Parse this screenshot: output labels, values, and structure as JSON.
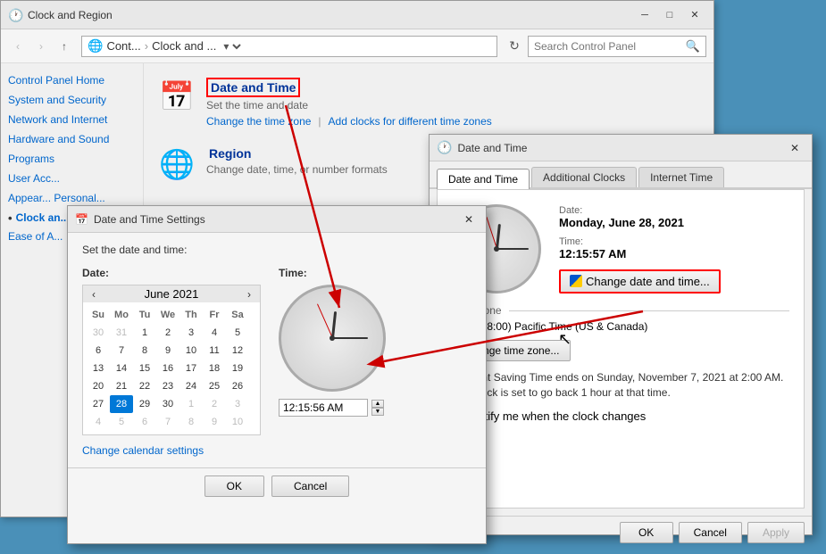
{
  "mainWindow": {
    "title": "Clock and Region",
    "icon": "🕐",
    "addressParts": [
      "Cont...",
      "Clock and ..."
    ],
    "searchPlaceholder": "Search Control Panel"
  },
  "sidebar": {
    "items": [
      {
        "label": "Control Panel Home"
      },
      {
        "label": "System and Security"
      },
      {
        "label": "Network and Internet"
      },
      {
        "label": "Hardware and Sound"
      },
      {
        "label": "Programs"
      },
      {
        "label": "User Acc..."
      },
      {
        "label": "Appear... Personal..."
      },
      {
        "label": "Clock an..."
      },
      {
        "label": "Ease of A..."
      }
    ]
  },
  "categories": [
    {
      "title": "Date and Time",
      "icon": "📅",
      "subtitle": "Set the time and date",
      "links": [
        "Change the time zone",
        "Add clocks for different time zones"
      ]
    },
    {
      "title": "Region",
      "icon": "🌐",
      "subtitle": "Change date, time, or number formats",
      "links": []
    }
  ],
  "dateTimeDialog": {
    "title": "Date and Time",
    "tabs": [
      "Date and Time",
      "Additional Clocks",
      "Internet Time"
    ],
    "activeTab": "Date and Time",
    "date": {
      "label": "Date:",
      "value": "Monday, June 28, 2021"
    },
    "time": {
      "label": "Time:",
      "value": "12:15:57 AM"
    },
    "changeBtn": "Change date and time...",
    "timezone": {
      "label": "Time zone",
      "value": "(UTC-08:00) Pacific Time (US & Canada)",
      "changeBtn": "Change time zone..."
    },
    "dstText": "Daylight Saving Time ends on Sunday, November 7, 2021 at 2:00 AM. The clock is set to go back 1 hour at that time.",
    "notifyLabel": "Notify me when the clock changes",
    "buttons": {
      "ok": "OK",
      "cancel": "Cancel",
      "apply": "Apply"
    }
  },
  "dtSettingsDialog": {
    "title": "Date and Time Settings",
    "instruction": "Set the date and time:",
    "dateLabel": "Date:",
    "timeLabel": "Time:",
    "calendar": {
      "month": "June 2021",
      "dayHeaders": [
        "Su",
        "Mo",
        "Tu",
        "We",
        "Th",
        "Fr",
        "Sa"
      ],
      "rows": [
        [
          "30",
          "31",
          "1",
          "2",
          "3",
          "4",
          "5"
        ],
        [
          "6",
          "7",
          "8",
          "9",
          "10",
          "11",
          "12"
        ],
        [
          "13",
          "14",
          "15",
          "16",
          "17",
          "18",
          "19"
        ],
        [
          "20",
          "21",
          "22",
          "23",
          "24",
          "25",
          "26"
        ],
        [
          "27",
          "28",
          "29",
          "30",
          "1",
          "2",
          "3"
        ],
        [
          "4",
          "5",
          "6",
          "7",
          "8",
          "9",
          "10"
        ]
      ],
      "selectedDay": "28",
      "otherMonthRows": [
        0,
        4,
        5
      ]
    },
    "timeValue": "12:15:56 AM",
    "calSettingsLink": "Change calendar settings",
    "buttons": {
      "ok": "OK",
      "cancel": "Cancel"
    }
  }
}
